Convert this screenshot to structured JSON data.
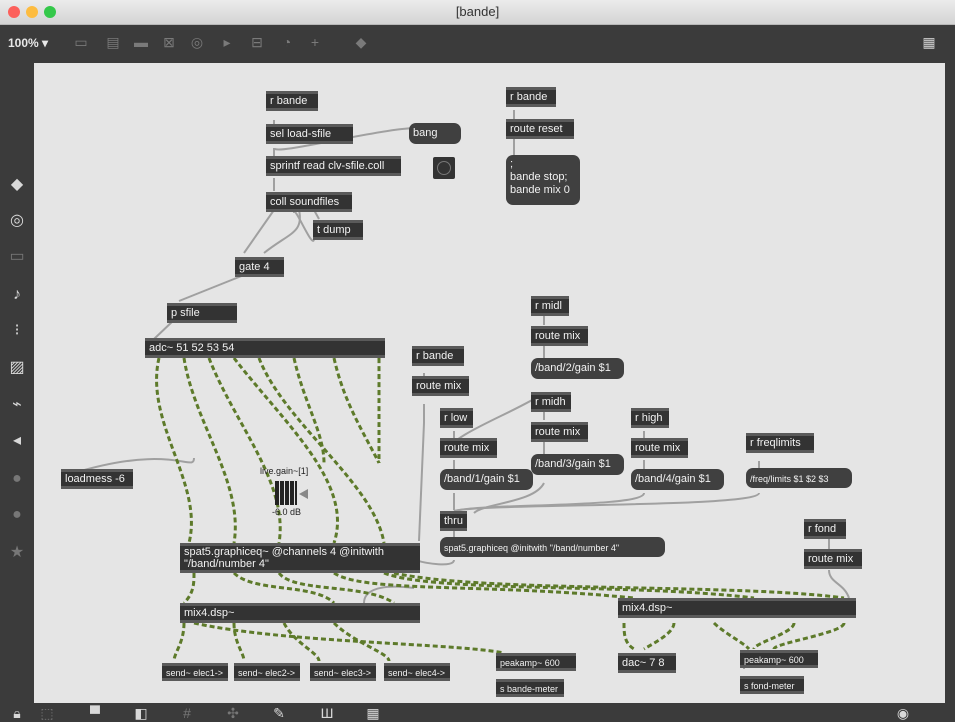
{
  "window": {
    "title": "[bande]"
  },
  "toolbar": {
    "zoom": "100%",
    "zoom_arrow": "▾"
  },
  "patch": {
    "objects": {
      "r_bande_1": "r bande",
      "sel_load": "sel load-sfile",
      "bang_msg": "bang",
      "sprintf": "sprintf read clv-sfile.coll",
      "coll": "coll soundfiles",
      "t_dump": "t dump",
      "gate": "gate 4",
      "p_sfile": "p sfile",
      "adc": "adc~ 51 52 53 54",
      "loadmess": "loadmess -6",
      "r_bande_2": "r bande",
      "route_reset": "route reset",
      "bande_msg": ";\nbande stop;\nbande mix 0",
      "r_bande_3": "r bande",
      "route_mix_1": "route mix",
      "r_midl": "r midl",
      "route_mix_midl": "route mix",
      "band2": "/band/2/gain $1",
      "r_midh": "r midh",
      "route_mix_midh": "route mix",
      "band3": "/band/3/gain $1",
      "r_low": "r low",
      "route_mix_low": "route mix",
      "band1": "/band/1/gain $1",
      "r_high": "r high",
      "route_mix_high": "route mix",
      "band4": "/band/4/gain $1",
      "r_freq": "r freqlimits",
      "freq_msg": "/freq/limits $1 $2 $3",
      "thru": "thru",
      "spat_msg": "spat5.graphiceq @initwith \"/band/number 4\"",
      "spat_obj": "spat5.graphiceq~ @channels 4 @initwith\n\"/band/number 4\"",
      "mix4_1": "mix4.dsp~",
      "send1": "send~ elec1->",
      "send2": "send~ elec2->",
      "send3": "send~ elec3->",
      "send4": "send~ elec4->",
      "peak1": "peakamp~ 600",
      "s_bande_meter": "s bande-meter",
      "r_fond": "r fond",
      "route_mix_fond": "route mix",
      "mix4_2": "mix4.dsp~",
      "dac": "dac~ 7 8",
      "peak2": "peakamp~ 600",
      "s_fond_meter": "s fond-meter"
    },
    "gain": {
      "label": "live.gain~[1]",
      "value": "-6.0 dB"
    }
  },
  "colors": {
    "canvas": "#e5e5e5",
    "object": "#333333",
    "wire_signal": "#5d7a2a",
    "wire_control": "#9c9c9c",
    "chrome": "#3b3b3b"
  }
}
